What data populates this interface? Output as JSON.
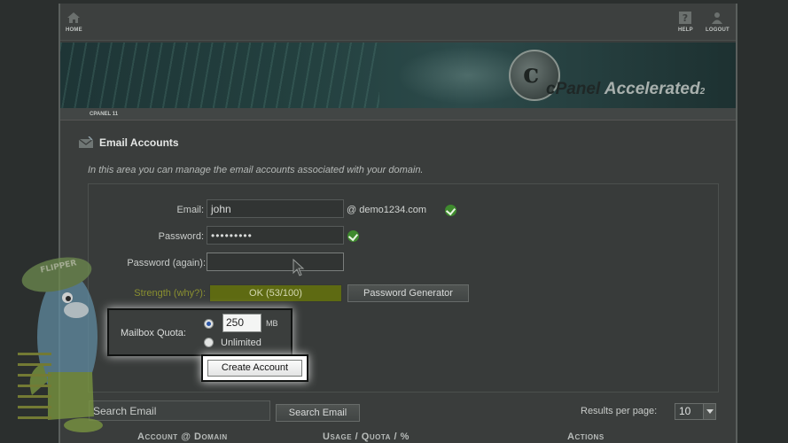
{
  "topnav": {
    "home": "HOME",
    "help": "HELP",
    "logout": "LOGOUT"
  },
  "banner": {
    "brand": "cPanel",
    "product": "Accelerated",
    "version": "2"
  },
  "breadcrumb": "CPANEL 11",
  "page": {
    "title": "Email Accounts",
    "description": "In this area you can manage the email accounts associated with your domain."
  },
  "form": {
    "email_label": "Email:",
    "email_value": "john",
    "domain": "@ demo1234.com",
    "password_label": "Password:",
    "password_value": "•••••••••",
    "password_again_label": "Password (again):",
    "password_again_value": "",
    "strength_label": "Strength (why?):",
    "strength_value": "OK (53/100)",
    "password_generator": "Password Generator",
    "quota_label": "Mailbox Quota:",
    "quota_value": "250",
    "quota_unit": "MB",
    "quota_unlimited": "Unlimited",
    "create_button": "Create Account"
  },
  "list": {
    "search_placeholder": "Search Email",
    "search_button": "Search Email",
    "results_label": "Results per page:",
    "results_value": "10",
    "columns": [
      "Account @ Domain",
      "Usage / Quota / %",
      "Actions"
    ]
  },
  "colors": {
    "accent_green": "#3f8a2e",
    "strength_bar": "#5e6a12"
  },
  "mascot": "Flipper Host"
}
